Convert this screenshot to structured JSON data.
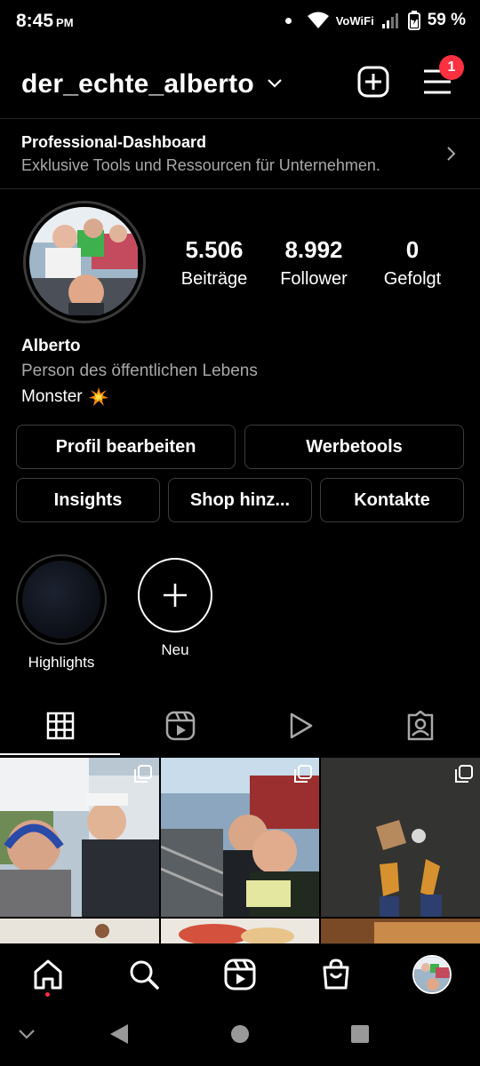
{
  "status_bar": {
    "time": "8:45",
    "ampm": "PM",
    "network": "VoWiFi",
    "battery": "59 %"
  },
  "header": {
    "username": "der_echte_alberto",
    "notification_count": "1",
    "icons": [
      "chevron-down-icon",
      "add-post-icon",
      "menu-icon"
    ]
  },
  "dashboard": {
    "title": "Professional-Dashboard",
    "subtitle": "Exklusive Tools und Ressourcen für Unternehmen."
  },
  "stats": [
    {
      "value": "5.506",
      "label": "Beiträge"
    },
    {
      "value": "8.992",
      "label": "Follower"
    },
    {
      "value": "0",
      "label": "Gefolgt"
    }
  ],
  "bio": {
    "name": "Alberto",
    "category": "Person des öffentlichen Lebens",
    "text": "Monster",
    "emoji": "collision-emoji"
  },
  "buttons": {
    "edit_profile": "Profil bearbeiten",
    "ad_tools": "Werbetools",
    "insights": "Insights",
    "shop": "Shop hinz...",
    "contacts": "Kontakte"
  },
  "highlights": [
    {
      "label": "Highlights"
    },
    {
      "label": "Neu"
    }
  ],
  "tabs": [
    "grid-icon",
    "reels-icon",
    "videos-icon",
    "tagged-icon"
  ],
  "bottom_nav": [
    "home-icon",
    "search-icon",
    "reels-icon",
    "shop-icon",
    "profile-avatar"
  ],
  "colors": {
    "background": "#000000",
    "badge": "#ff3040",
    "secondary_text": "#a8a8a8",
    "border": "#3c3c3c"
  }
}
